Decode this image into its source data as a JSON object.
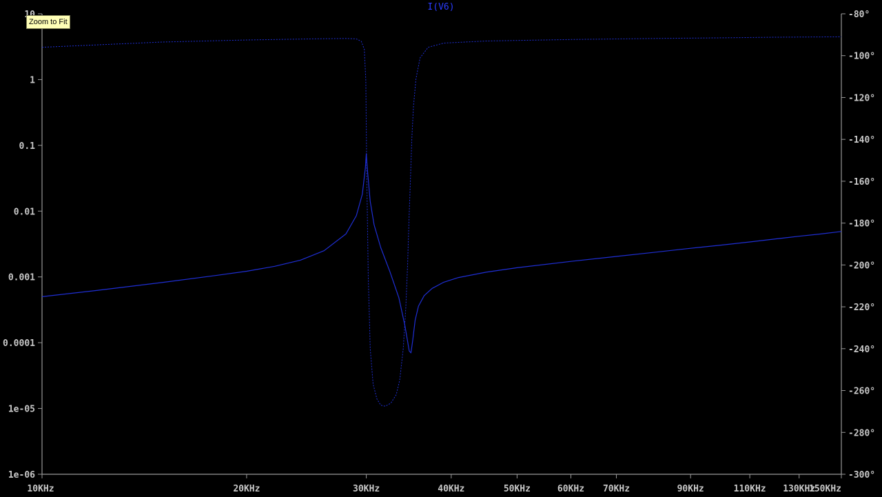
{
  "window": {
    "tooltip": "Zoom to Fit"
  },
  "colors": {
    "background": "#000000",
    "axis": "#9a9a9a",
    "tick_label": "#c8c8c8",
    "trace": "#1f2fd6",
    "title": "#2a3cff",
    "tooltip_bg": "#fefeb6"
  },
  "chart_data": {
    "type": "line",
    "title": "I(V6)",
    "x_axis": {
      "scale": "log",
      "unit": "Hz",
      "range": [
        10000,
        150000
      ],
      "ticks": [
        {
          "value": 10000,
          "label": "10KHz"
        },
        {
          "value": 20000,
          "label": "20KHz"
        },
        {
          "value": 30000,
          "label": "30KHz"
        },
        {
          "value": 40000,
          "label": "40KHz"
        },
        {
          "value": 50000,
          "label": "50KHz"
        },
        {
          "value": 60000,
          "label": "60KHz"
        },
        {
          "value": 70000,
          "label": "70KHz"
        },
        {
          "value": 90000,
          "label": "90KHz"
        },
        {
          "value": 110000,
          "label": "110KHz"
        },
        {
          "value": 130000,
          "label": "130KHz"
        },
        {
          "value": 150000,
          "label": "150KHz"
        }
      ]
    },
    "y_left": {
      "scale": "log",
      "range": [
        1e-06,
        10
      ],
      "ticks": [
        {
          "value": 10,
          "label": "10"
        },
        {
          "value": 1,
          "label": "1"
        },
        {
          "value": 0.1,
          "label": "0.1"
        },
        {
          "value": 0.01,
          "label": "0.01"
        },
        {
          "value": 0.001,
          "label": "0.001"
        },
        {
          "value": 0.0001,
          "label": "0.0001"
        },
        {
          "value": 1e-05,
          "label": "1e-05"
        },
        {
          "value": 1e-06,
          "label": "1e-06"
        }
      ]
    },
    "y_right": {
      "scale": "linear",
      "unit": "degrees",
      "range": [
        -300,
        -80
      ],
      "ticks": [
        {
          "value": -80,
          "label": "-80°"
        },
        {
          "value": -100,
          "label": "-100°"
        },
        {
          "value": -120,
          "label": "-120°"
        },
        {
          "value": -140,
          "label": "-140°"
        },
        {
          "value": -160,
          "label": "-160°"
        },
        {
          "value": -180,
          "label": "-180°"
        },
        {
          "value": -200,
          "label": "-200°"
        },
        {
          "value": -220,
          "label": "-220°"
        },
        {
          "value": -240,
          "label": "-240°"
        },
        {
          "value": -260,
          "label": "-260°"
        },
        {
          "value": -280,
          "label": "-280°"
        },
        {
          "value": -300,
          "label": "-300°"
        }
      ]
    },
    "grid": false,
    "series": [
      {
        "axis": "left",
        "style": "solid",
        "x": [
          10000,
          12000,
          15000,
          18000,
          20000,
          22000,
          24000,
          26000,
          28000,
          29000,
          29600,
          29900,
          30000,
          30100,
          30400,
          30800,
          31500,
          32500,
          33500,
          34200,
          34700,
          34900,
          35100,
          35400,
          35800,
          36500,
          37500,
          39000,
          41000,
          45000,
          50000,
          60000,
          70000,
          80000,
          90000,
          100000,
          110000,
          120000,
          130000,
          140000,
          150000
        ],
        "y": [
          0.0005,
          0.00062,
          0.00082,
          0.00105,
          0.00122,
          0.00145,
          0.0018,
          0.0025,
          0.0045,
          0.0085,
          0.018,
          0.045,
          0.075,
          0.045,
          0.014,
          0.0062,
          0.0028,
          0.0012,
          0.00048,
          0.00018,
          7.5e-05,
          7e-05,
          0.000105,
          0.00022,
          0.00036,
          0.00052,
          0.00067,
          0.00083,
          0.00098,
          0.00118,
          0.00138,
          0.00172,
          0.00205,
          0.00238,
          0.00272,
          0.00305,
          0.0034,
          0.00378,
          0.00415,
          0.0045,
          0.0049
        ]
      },
      {
        "axis": "right",
        "style": "dashed",
        "x": [
          10000,
          15000,
          20000,
          25000,
          28000,
          29000,
          29500,
          29800,
          29950,
          30050,
          30200,
          30400,
          30700,
          31100,
          31500,
          32000,
          32600,
          33200,
          33600,
          34000,
          34300,
          34500,
          34700,
          34850,
          35000,
          35200,
          35500,
          36000,
          37000,
          39000,
          45000,
          60000,
          80000,
          100000,
          120000,
          150000
        ],
        "y": [
          -96,
          -93.5,
          -92.5,
          -92,
          -91.8,
          -92,
          -93.2,
          -97,
          -112,
          -158,
          -205,
          -240,
          -257,
          -264,
          -267,
          -267.5,
          -266,
          -262,
          -255,
          -240,
          -220,
          -200,
          -175,
          -158,
          -140,
          -124,
          -111,
          -101,
          -96,
          -94,
          -93,
          -92.3,
          -91.8,
          -91.5,
          -91.2,
          -91
        ]
      }
    ]
  }
}
